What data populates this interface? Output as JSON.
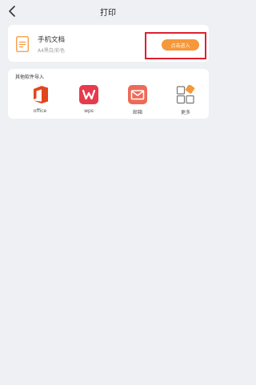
{
  "header": {
    "title": "打印"
  },
  "document": {
    "title": "手机文档",
    "subtitle": "A4黑白/彩色",
    "button_label": "点击进入"
  },
  "import_section": {
    "heading": "其他软件导入",
    "apps": [
      {
        "label": "office",
        "icon": "office-icon"
      },
      {
        "label": "wps",
        "icon": "wps-icon"
      },
      {
        "label": "邮箱",
        "icon": "mail-icon"
      },
      {
        "label": "更多",
        "icon": "more-grid-icon"
      }
    ]
  },
  "colors": {
    "accent": "#f5983a",
    "highlight": "#e02030",
    "office": "#e2461c",
    "wps": "#e63b4d",
    "mail": "#ee6a58"
  }
}
